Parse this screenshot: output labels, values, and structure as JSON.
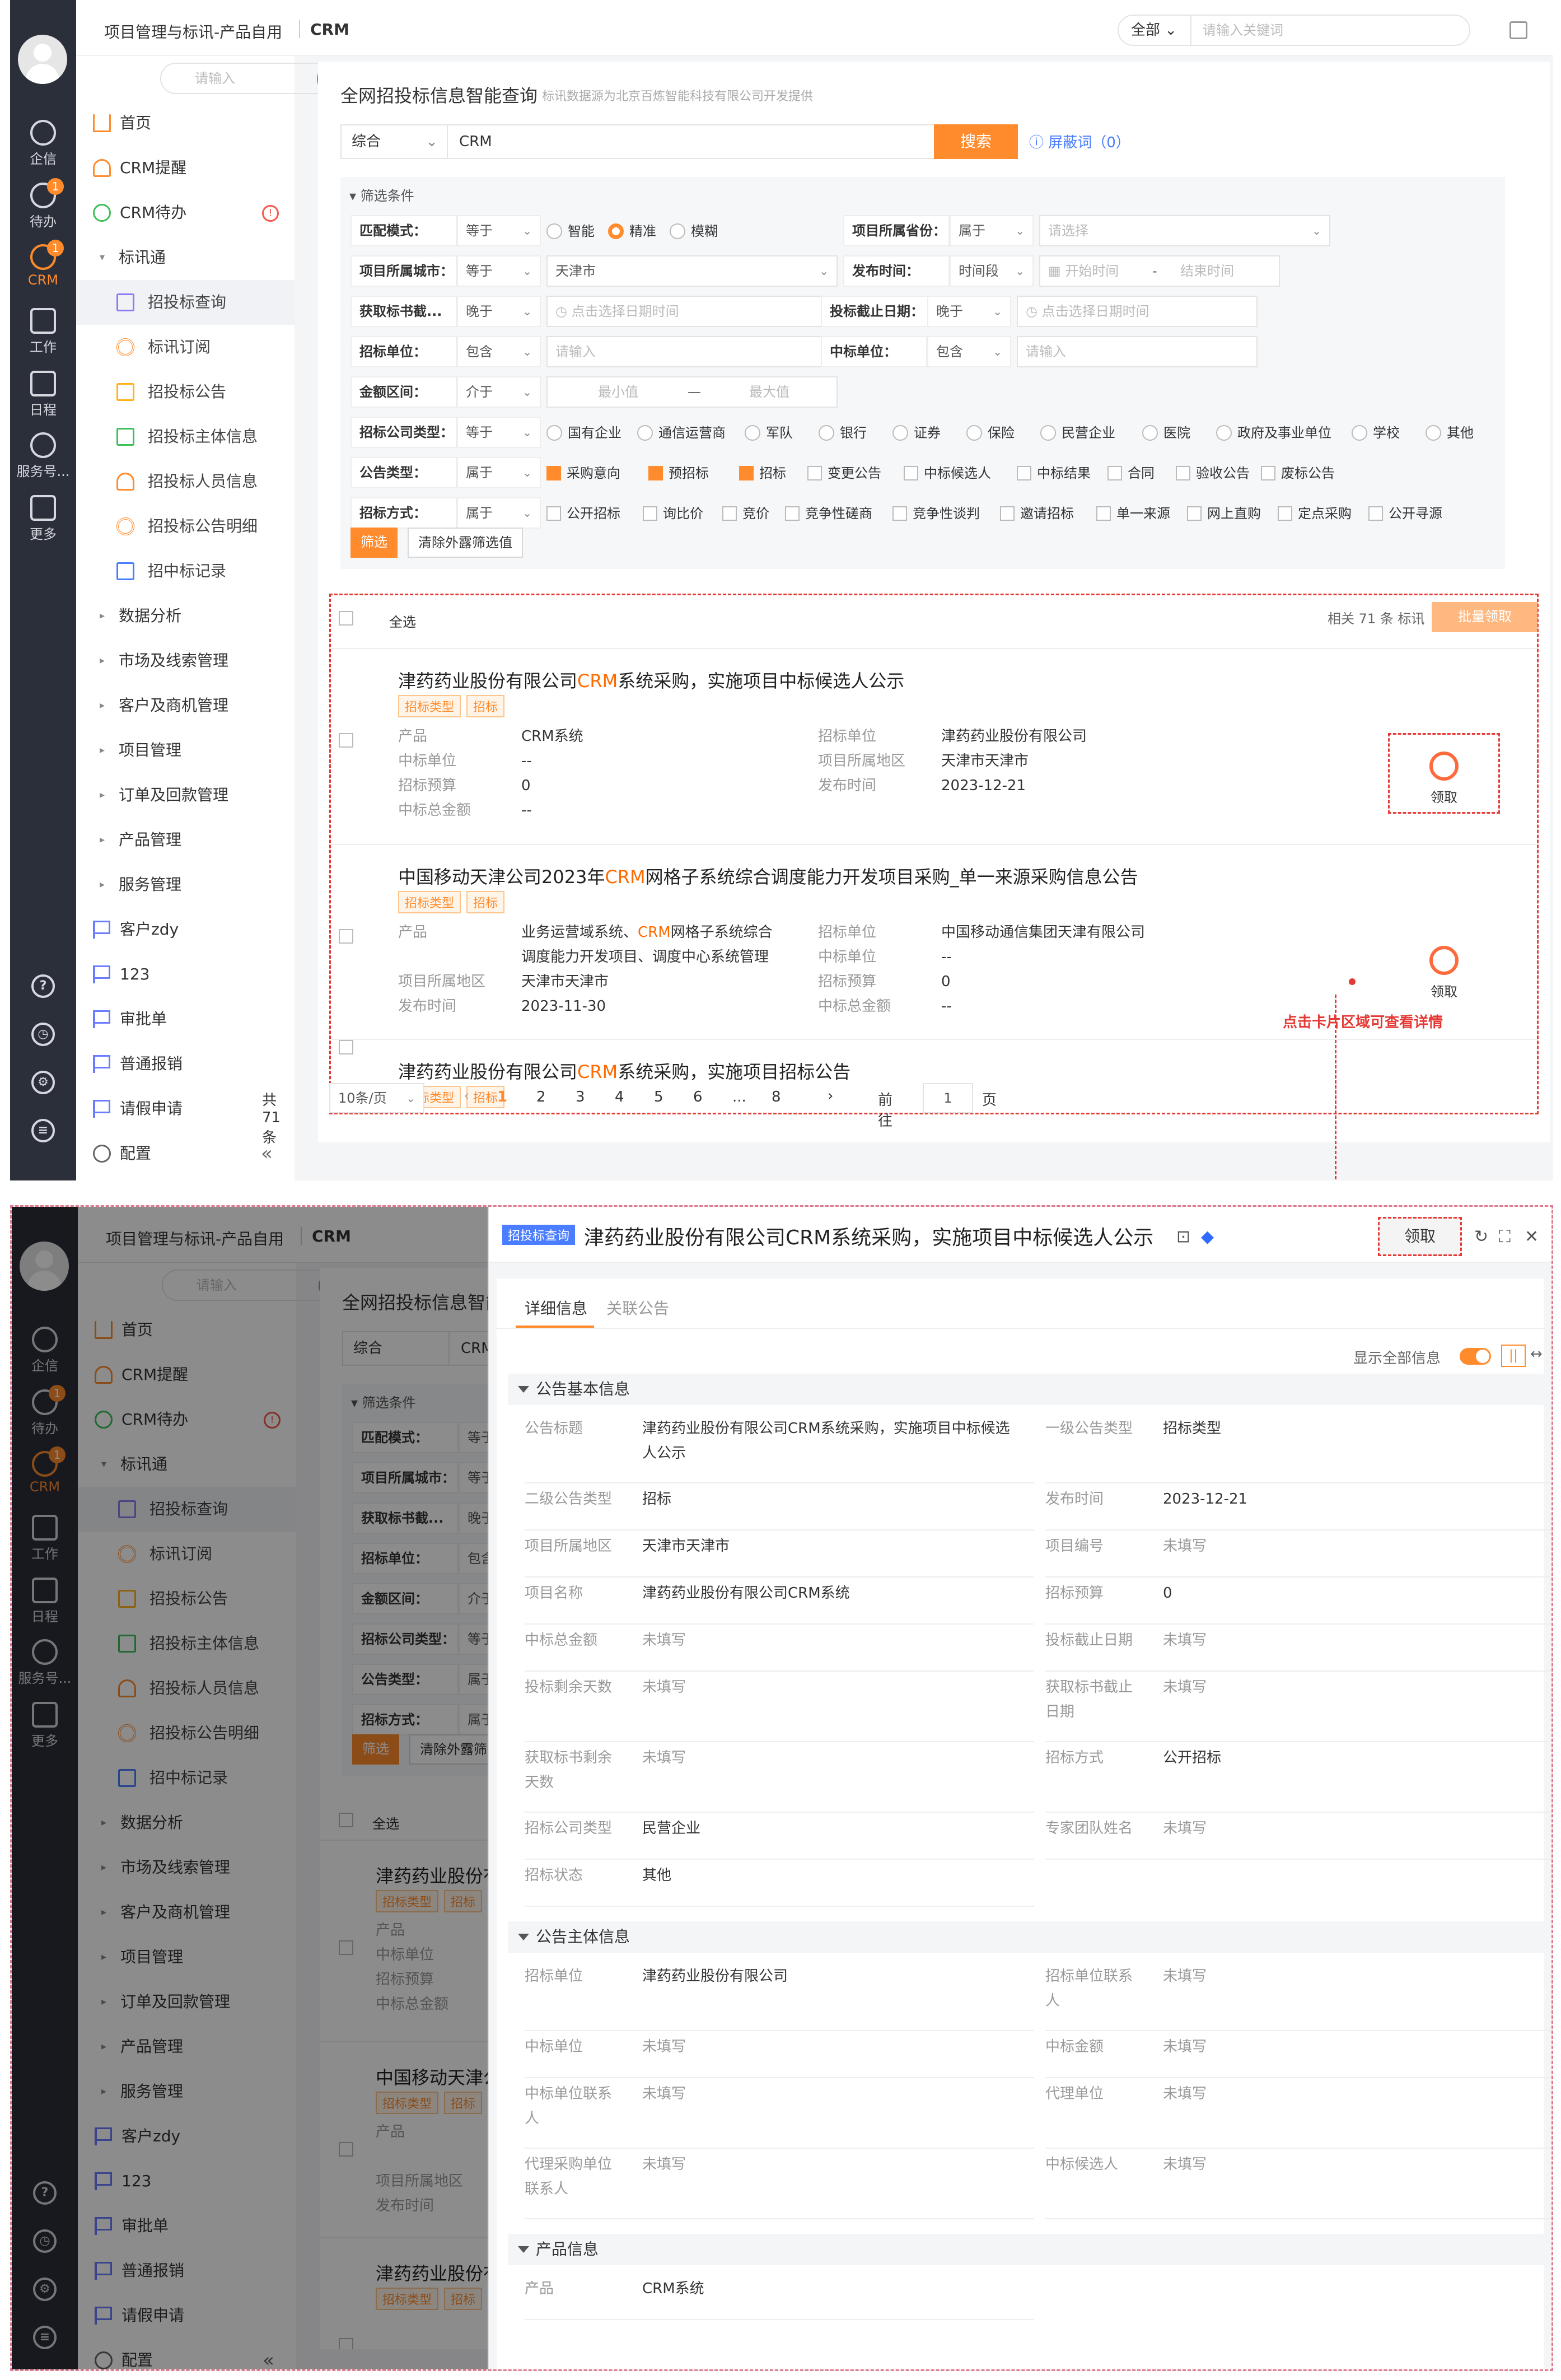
{
  "app": {
    "crumb": "项目管理与标讯-产品自用",
    "module": "CRM",
    "global_select": "全部",
    "global_placeholder": "请输入关键词",
    "sidebar_search": "请输入"
  },
  "rail": [
    {
      "label": "企信",
      "badge": ""
    },
    {
      "label": "待办",
      "badge": "1"
    },
    {
      "label": "CRM",
      "badge": "1"
    },
    {
      "label": "工作",
      "badge": ""
    },
    {
      "label": "日程",
      "badge": ""
    },
    {
      "label": "服务号...",
      "badge": ""
    },
    {
      "label": "更多",
      "badge": ""
    }
  ],
  "rail_bottom": [
    "?",
    "◷",
    "⚙",
    "≡"
  ],
  "sidebar": {
    "items": [
      {
        "label": "首页"
      },
      {
        "label": "CRM提醒"
      },
      {
        "label": "CRM待办",
        "badge": "!"
      },
      {
        "label": "标讯通"
      },
      {
        "label": "招投标查询"
      },
      {
        "label": "标讯订阅"
      },
      {
        "label": "招投标公告"
      },
      {
        "label": "招投标主体信息"
      },
      {
        "label": "招投标人员信息"
      },
      {
        "label": "招投标公告明细"
      },
      {
        "label": "招中标记录"
      },
      {
        "label": "数据分析"
      },
      {
        "label": "市场及线索管理"
      },
      {
        "label": "客户及商机管理"
      },
      {
        "label": "项目管理"
      },
      {
        "label": "订单及回款管理"
      },
      {
        "label": "产品管理"
      },
      {
        "label": "服务管理"
      },
      {
        "label": "客户zdy"
      },
      {
        "label": "123"
      },
      {
        "label": "审批单"
      },
      {
        "label": "普通报销"
      },
      {
        "label": "请假申请"
      },
      {
        "label": "配置"
      }
    ],
    "collapse": "«"
  },
  "query": {
    "title": "全网招投标信息智能查询",
    "subtitle": "标讯数据源为北京百炼智能科技有限公司开发提供",
    "scope": "综合",
    "keyword": "CRM",
    "search_btn": "搜索",
    "shield": "屏蔽词（0）"
  },
  "filters": {
    "header": "筛选条件",
    "match_mode": {
      "label": "匹配模式：",
      "op": "等于",
      "options": [
        {
          "t": "智能",
          "on": false
        },
        {
          "t": "精准",
          "on": true
        },
        {
          "t": "模糊",
          "on": false
        }
      ]
    },
    "province": {
      "label": "项目所属省份：",
      "op": "属于",
      "ph": "请选择"
    },
    "city": {
      "label": "项目所属城市：",
      "op": "等于",
      "value": "天津市"
    },
    "pubtime": {
      "label": "发布时间：",
      "op": "时间段",
      "start": "开始时间",
      "dash": "-",
      "end": "结束时间"
    },
    "doc_deadline": {
      "label": "获取标书截...",
      "op": "晚于",
      "ph": "点击选择日期时间"
    },
    "bid_deadline": {
      "label": "投标截止日期：",
      "op": "晚于",
      "ph": "点击选择日期时间"
    },
    "bidder": {
      "label": "招标单位：",
      "op": "包含",
      "ph": "请输入"
    },
    "winner": {
      "label": "中标单位：",
      "op": "包含",
      "ph": "请输入"
    },
    "amount": {
      "label": "金额区间：",
      "op": "介于",
      "min": "最小值",
      "dash": "—",
      "max": "最大值"
    },
    "company_type": {
      "label": "招标公司类型：",
      "op": "等于",
      "options": [
        {
          "t": "国有企业",
          "on": false
        },
        {
          "t": "通信运营商",
          "on": false
        },
        {
          "t": "军队",
          "on": false
        },
        {
          "t": "银行",
          "on": false
        },
        {
          "t": "证券",
          "on": false
        },
        {
          "t": "保险",
          "on": false
        },
        {
          "t": "民营企业",
          "on": false
        },
        {
          "t": "医院",
          "on": false
        },
        {
          "t": "政府及事业单位",
          "on": false
        },
        {
          "t": "学校",
          "on": false
        },
        {
          "t": "其他",
          "on": false
        }
      ]
    },
    "notice_type": {
      "label": "公告类型：",
      "op": "属于",
      "options": [
        {
          "t": "采购意向",
          "on": true
        },
        {
          "t": "预招标",
          "on": true
        },
        {
          "t": "招标",
          "on": true
        },
        {
          "t": "变更公告",
          "on": false
        },
        {
          "t": "中标候选人",
          "on": false
        },
        {
          "t": "中标结果",
          "on": false
        },
        {
          "t": "合同",
          "on": false
        },
        {
          "t": "验收公告",
          "on": false
        },
        {
          "t": "废标公告",
          "on": false
        }
      ]
    },
    "bid_method": {
      "label": "招标方式：",
      "op": "属于",
      "options": [
        {
          "t": "公开招标",
          "on": false
        },
        {
          "t": "询比价",
          "on": false
        },
        {
          "t": "竞价",
          "on": false
        },
        {
          "t": "竞争性磋商",
          "on": false
        },
        {
          "t": "竞争性谈判",
          "on": false
        },
        {
          "t": "邀请招标",
          "on": false
        },
        {
          "t": "单一来源",
          "on": false
        },
        {
          "t": "网上直购",
          "on": false
        },
        {
          "t": "定点采购",
          "on": false
        },
        {
          "t": "公开寻源",
          "on": false
        }
      ]
    },
    "apply_btn": "筛选",
    "clear_btn": "清除外露筛选值"
  },
  "results": {
    "select_all": "全选",
    "count": "相关 71 条 标讯",
    "batch_btn": "批量领取",
    "annotation": "点击卡片区域可查看详情",
    "claim": "领取",
    "cards": [
      {
        "title_pre": "津药药业股份有限公司",
        "title_hl": "CRM",
        "title_post": "系统采购，实施项目中标候选人公示",
        "tags": [
          "招标类型",
          "招标"
        ],
        "left": [
          {
            "k": "产品",
            "v": "CRM系统",
            "hl": true
          },
          {
            "k": "中标单位",
            "v": "--"
          },
          {
            "k": "招标预算",
            "v": "0",
            "hl": true
          },
          {
            "k": "中标总金额",
            "v": "--"
          }
        ],
        "right": [
          {
            "k": "招标单位",
            "v": "津药药业股份有限公司"
          },
          {
            "k": "项目所属地区",
            "v": "天津市天津市"
          },
          {
            "k": "发布时间",
            "v": "2023-12-21"
          }
        ]
      },
      {
        "title_pre": "中国移动天津公司2023年",
        "title_hl": "CRM",
        "title_post": "网格子系统综合调度能力开发项目采购_单一来源采购信息公告",
        "tags": [
          "招标类型",
          "招标"
        ],
        "product_line1_pre": "业务运营域系统、",
        "product_line1_hl": "CRM",
        "product_line1_post": "网格子系统综合",
        "product_line2": "调度能力开发项目、调度中心系统管理",
        "left": [
          {
            "k": "产品",
            "v": ""
          },
          {
            "k": "项目所属地区",
            "v": "天津市天津市"
          },
          {
            "k": "发布时间",
            "v": "2023-11-30"
          }
        ],
        "right": [
          {
            "k": "招标单位",
            "v": "中国移动通信集团天津有限公司"
          },
          {
            "k": "中标单位",
            "v": "--"
          },
          {
            "k": "招标预算",
            "v": "0",
            "hl": true
          },
          {
            "k": "中标总金额",
            "v": "--"
          }
        ]
      },
      {
        "title_pre": "津药药业股份有限公司",
        "title_hl": "CRM",
        "title_post": "系统采购，实施项目招标公告",
        "tags": [
          "招标类型",
          "招标"
        ]
      }
    ]
  },
  "pager": {
    "total": "共 71 条",
    "size": "10条/页",
    "prev": "‹",
    "pages": [
      "1",
      "2",
      "3",
      "4",
      "5",
      "6",
      "...",
      "8"
    ],
    "next": "›",
    "goto": "前往",
    "page_value": "1",
    "page_unit": "页"
  },
  "detail": {
    "tag": "招投标查询",
    "title": "津药药业股份有限公司CRM系统采购，实施项目中标候选人公示",
    "claim": "领取",
    "tabs": [
      "详细信息",
      "关联公告"
    ],
    "show_all": "显示全部信息",
    "sections": [
      {
        "title": "公告基本信息",
        "rows": [
          [
            {
              "k": "公告标题",
              "v": "津药药业股份有限公司CRM系统采购，实施项目中标候选人公示"
            },
            {
              "k": "一级公告类型",
              "v": "招标类型"
            }
          ],
          [
            {
              "k": "二级公告类型",
              "v": "招标"
            },
            {
              "k": "发布时间",
              "v": "2023-12-21"
            }
          ],
          [
            {
              "k": "项目所属地区",
              "v": "天津市天津市"
            },
            {
              "k": "项目编号",
              "v": "未填写",
              "empty": true
            }
          ],
          [
            {
              "k": "项目名称",
              "v": "津药药业股份有限公司CRM系统"
            },
            {
              "k": "招标预算",
              "v": "0"
            }
          ],
          [
            {
              "k": "中标总金额",
              "v": "未填写",
              "empty": true
            },
            {
              "k": "投标截止日期",
              "v": "未填写",
              "empty": true
            }
          ],
          [
            {
              "k": "投标剩余天数",
              "v": "未填写",
              "empty": true
            },
            {
              "k": "获取标书截止日期",
              "v": "未填写",
              "empty": true
            }
          ],
          [
            {
              "k": "获取标书剩余天数",
              "v": "未填写",
              "empty": true
            },
            {
              "k": "招标方式",
              "v": "公开招标"
            }
          ],
          [
            {
              "k": "招标公司类型",
              "v": "民营企业"
            },
            {
              "k": "专家团队姓名",
              "v": "未填写",
              "empty": true
            }
          ],
          [
            {
              "k": "招标状态",
              "v": "其他"
            }
          ]
        ]
      },
      {
        "title": "公告主体信息",
        "rows": [
          [
            {
              "k": "招标单位",
              "v": "津药药业股份有限公司"
            },
            {
              "k": "招标单位联系人",
              "v": "未填写",
              "empty": true
            }
          ],
          [
            {
              "k": "中标单位",
              "v": "未填写",
              "empty": true
            },
            {
              "k": "中标金额",
              "v": "未填写",
              "empty": true
            }
          ],
          [
            {
              "k": "中标单位联系人",
              "v": "未填写",
              "empty": true
            },
            {
              "k": "代理单位",
              "v": "未填写",
              "empty": true
            }
          ],
          [
            {
              "k": "代理采购单位联系人",
              "v": "未填写",
              "empty": true
            },
            {
              "k": "中标候选人",
              "v": "未填写",
              "empty": true
            }
          ]
        ]
      },
      {
        "title": "产品信息",
        "rows": [
          [
            {
              "k": "产品",
              "v": "CRM系统"
            }
          ]
        ]
      }
    ]
  },
  "colors": {
    "accent": "#ff8b2c",
    "highlight": "#ff6a00",
    "link": "#4a7dff",
    "annot": "#e53935",
    "rail": "#2b2f3a"
  }
}
